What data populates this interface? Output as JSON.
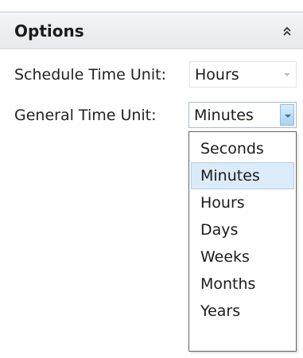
{
  "options": {
    "title": "Options",
    "collapse_icon": "double-chevron-up-icon"
  },
  "fields": {
    "schedule_time_unit": {
      "label": "Schedule Time Unit:",
      "value": "Hours"
    },
    "general_time_unit": {
      "label": "General Time Unit:",
      "value": "Minutes"
    }
  },
  "dropdown": {
    "options": [
      "Seconds",
      "Minutes",
      "Hours",
      "Days",
      "Weeks",
      "Months",
      "Years"
    ],
    "selected_index": 1
  },
  "colors": {
    "header_bg": "#e9ecef",
    "selected_item_bg": "#dcebf9",
    "selected_item_border": "#a8cdee",
    "dropdown_button_accent": "#a9d3f2"
  }
}
